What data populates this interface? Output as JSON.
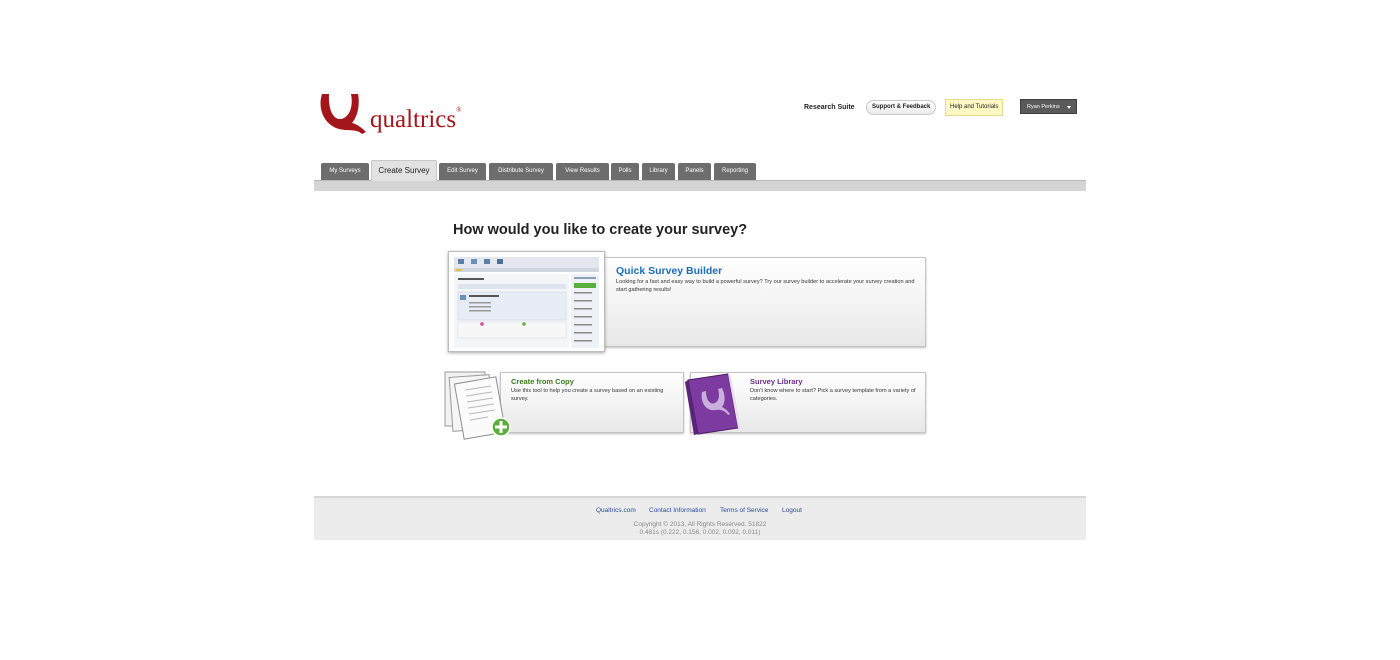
{
  "header": {
    "logo_text": "qualtrics",
    "logo_reg": "®",
    "research_suite": "Research Suite",
    "support_label": "Support & Feedback",
    "help_label": "Help and Tutorials",
    "user_name": "Ryan Perkins"
  },
  "tabs": [
    {
      "label": "My Surveys"
    },
    {
      "label": "Create Survey"
    },
    {
      "label": "Edit Survey"
    },
    {
      "label": "Distribute Survey"
    },
    {
      "label": "View Results"
    },
    {
      "label": "Polls"
    },
    {
      "label": "Library"
    },
    {
      "label": "Panels"
    },
    {
      "label": "Reporting"
    }
  ],
  "main": {
    "question": "How would you like to create your survey?",
    "quick": {
      "title": "Quick Survey Builder",
      "desc": "Looking for a fast and easy way to build a powerful survey? Try our survey builder to accelerate your survey creation and start gathering results!"
    },
    "copy": {
      "title": "Create from Copy",
      "desc": "Use this tool to help you create a survey based on an existing survey."
    },
    "library": {
      "title": "Survey Library",
      "desc": "Don't know where to start? Pick a survey template from a variety of categories."
    }
  },
  "footer": {
    "links": [
      "Qualtrics.com",
      "Contact Information",
      "Terms of Service",
      "Logout"
    ],
    "copyright_line1": "Copyright © 2013, All Rights Reserved. 51822",
    "copyright_line2": "0.481s (0.222, 0.156, 0.002, 0.092, 0.011)"
  },
  "colors": {
    "brand_red": "#a3161b",
    "link_blue": "#1c6bb8",
    "copy_green": "#3b7d1f",
    "library_purple": "#6b2a8c"
  }
}
